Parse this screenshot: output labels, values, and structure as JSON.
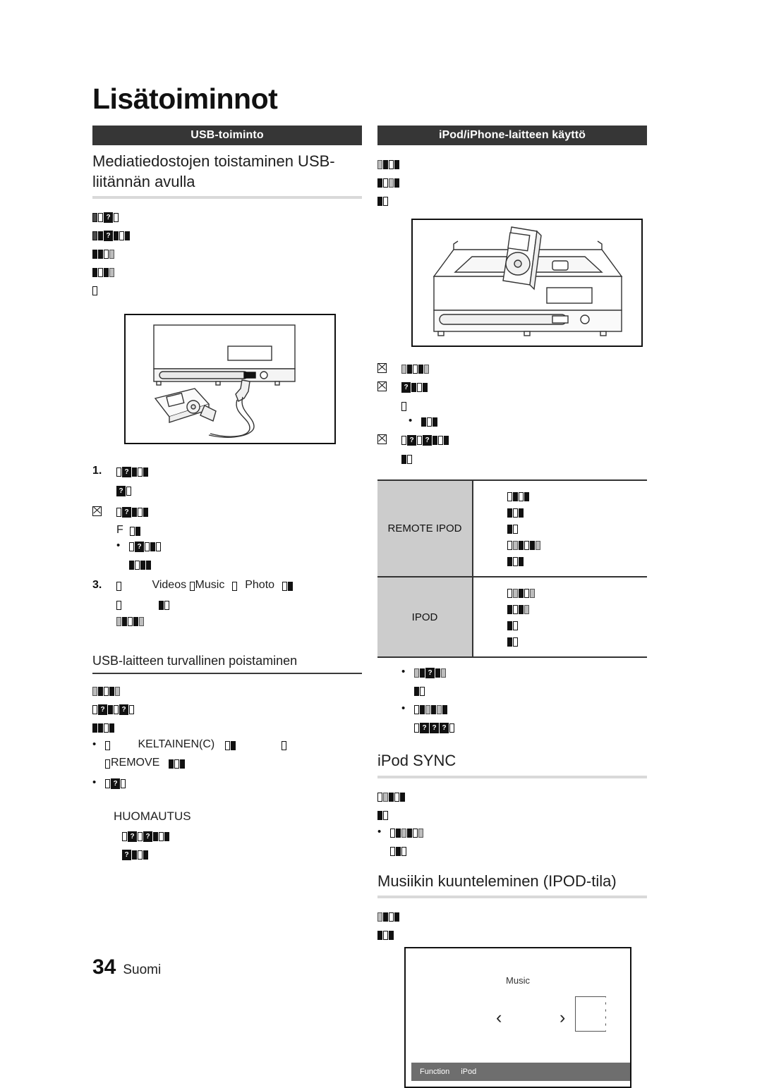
{
  "page": {
    "title": "Lisätoiminnot",
    "footer_page_number": "34",
    "footer_language": "Suomi"
  },
  "sections": {
    "left_bar_label": "USB-toiminto",
    "right_bar_label": "iPod/iPhone-laitteen käyttö"
  },
  "left_column": {
    "heading": "Mediatiedostojen toistaminen USB-liitännän avulla",
    "steps": {
      "step1_marker": "1.",
      "step2_marker": "",
      "step3_marker": "3.",
      "step3_words": {
        "videos": "Videos",
        "music": "Music",
        "photo": "Photo"
      },
      "sub_label": "F"
    },
    "subheading": "USB-laitteen turvallinen poistaminen",
    "removal": {
      "yellow_label": "KELTAINEN(C)",
      "remove_label": "REMOVE"
    },
    "note_title": "HUOMAUTUS"
  },
  "right_column": {
    "table": {
      "rows": [
        {
          "label": "REMOTE IPOD"
        },
        {
          "label": "IPOD"
        }
      ]
    },
    "sync_heading": "iPod SYNC",
    "music_heading": "Musiikin kuunteleminen (IPOD-tila)",
    "screen": {
      "title": "Music",
      "arrow_prev": "‹",
      "arrow_next": "›",
      "status_function_label": "Function",
      "status_source_label": "iPod"
    }
  },
  "colors": {
    "section_bar": "#363636",
    "heading_rule": "#d9d9d9",
    "table_label_cell": "#cccccc",
    "status_bar": "#6e6e6e"
  }
}
